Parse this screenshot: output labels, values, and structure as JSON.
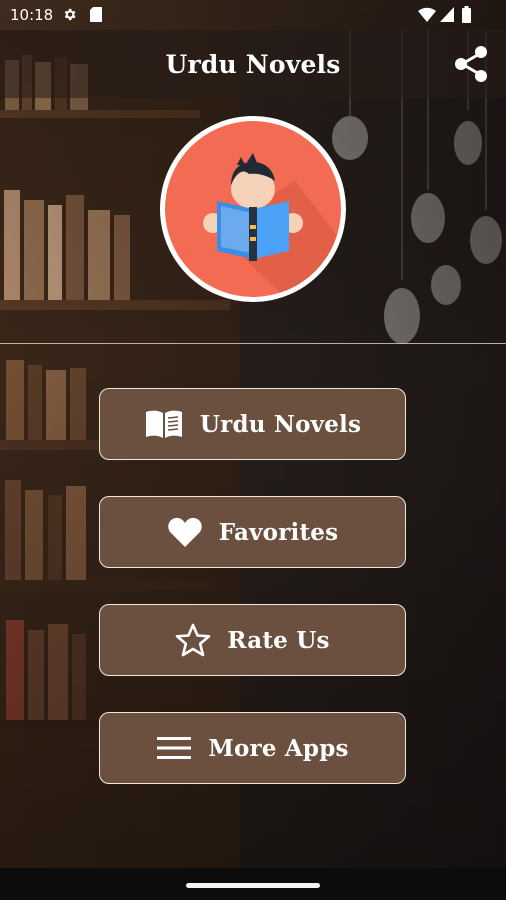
{
  "status_bar": {
    "time": "10:18",
    "icons": [
      "settings-icon",
      "sd-card-icon",
      "wifi-icon",
      "signal-icon",
      "battery-icon"
    ]
  },
  "app_bar": {
    "title": "Urdu Novels",
    "share_icon": "share-icon"
  },
  "logo": {
    "icon": "reader-with-book-icon",
    "background_color": "#f26b52"
  },
  "menu": {
    "items": [
      {
        "label": "Urdu Novels",
        "icon": "open-book-icon"
      },
      {
        "label": "Favorites",
        "icon": "heart-icon"
      },
      {
        "label": "Rate Us",
        "icon": "star-outline-icon"
      },
      {
        "label": "More Apps",
        "icon": "menu-lines-icon"
      }
    ]
  },
  "colors": {
    "button_fill": "#6b5040",
    "button_border": "#efe7dc",
    "text": "#ffffff"
  }
}
